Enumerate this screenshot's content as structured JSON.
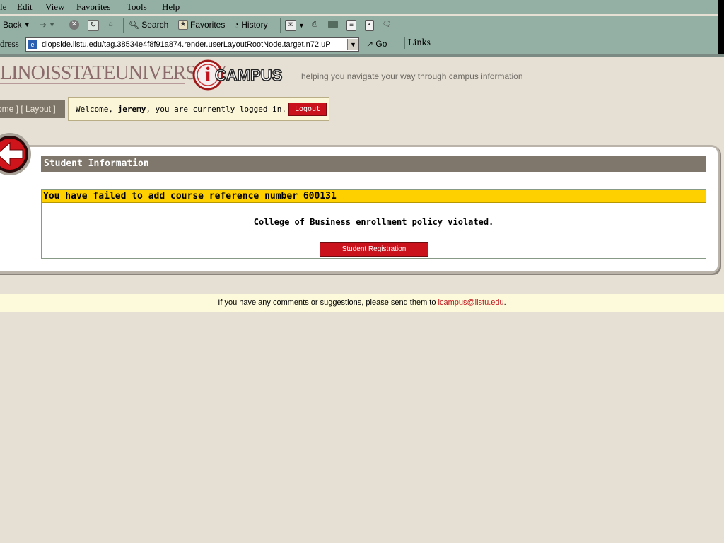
{
  "menu": [
    "le",
    "Edit",
    "View",
    "Favorites",
    "Tools",
    "Help"
  ],
  "toolbar": {
    "back": "Back",
    "search": "Search",
    "favorites": "Favorites",
    "history": "History"
  },
  "address": {
    "label": "dress",
    "url": "diopside.ilstu.edu/tag.38534e4f8f91a874.render.userLayoutRootNode.target.n72.uP",
    "go": "Go",
    "links": "Links"
  },
  "header": {
    "university": "LINOISSTATEUNIVERSITY",
    "logo_text": "CAMPUS",
    "tagline": "helping you navigate your way through campus information"
  },
  "nav": {
    "home": "ome",
    "layout": "Layout",
    "welcome_prefix": "Welcome, ",
    "username": "jeremy",
    "welcome_suffix": ", you are currently logged in.",
    "logout": "Logout"
  },
  "panel": {
    "title": "Student Information",
    "error_title": "You have failed to add course reference number 600131",
    "error_message": "College of Business enrollment policy violated.",
    "button": "Student Registration"
  },
  "footer": {
    "text": "If you have any comments or suggestions, please send them to ",
    "email": "icampus@ilstu.edu",
    "end": "."
  },
  "colors": {
    "chrome": "#94b0a4",
    "page_bg": "#e6e0d4",
    "accent_red": "#c9121c",
    "error_yellow": "#fed000",
    "section_bar": "#7f776b"
  }
}
